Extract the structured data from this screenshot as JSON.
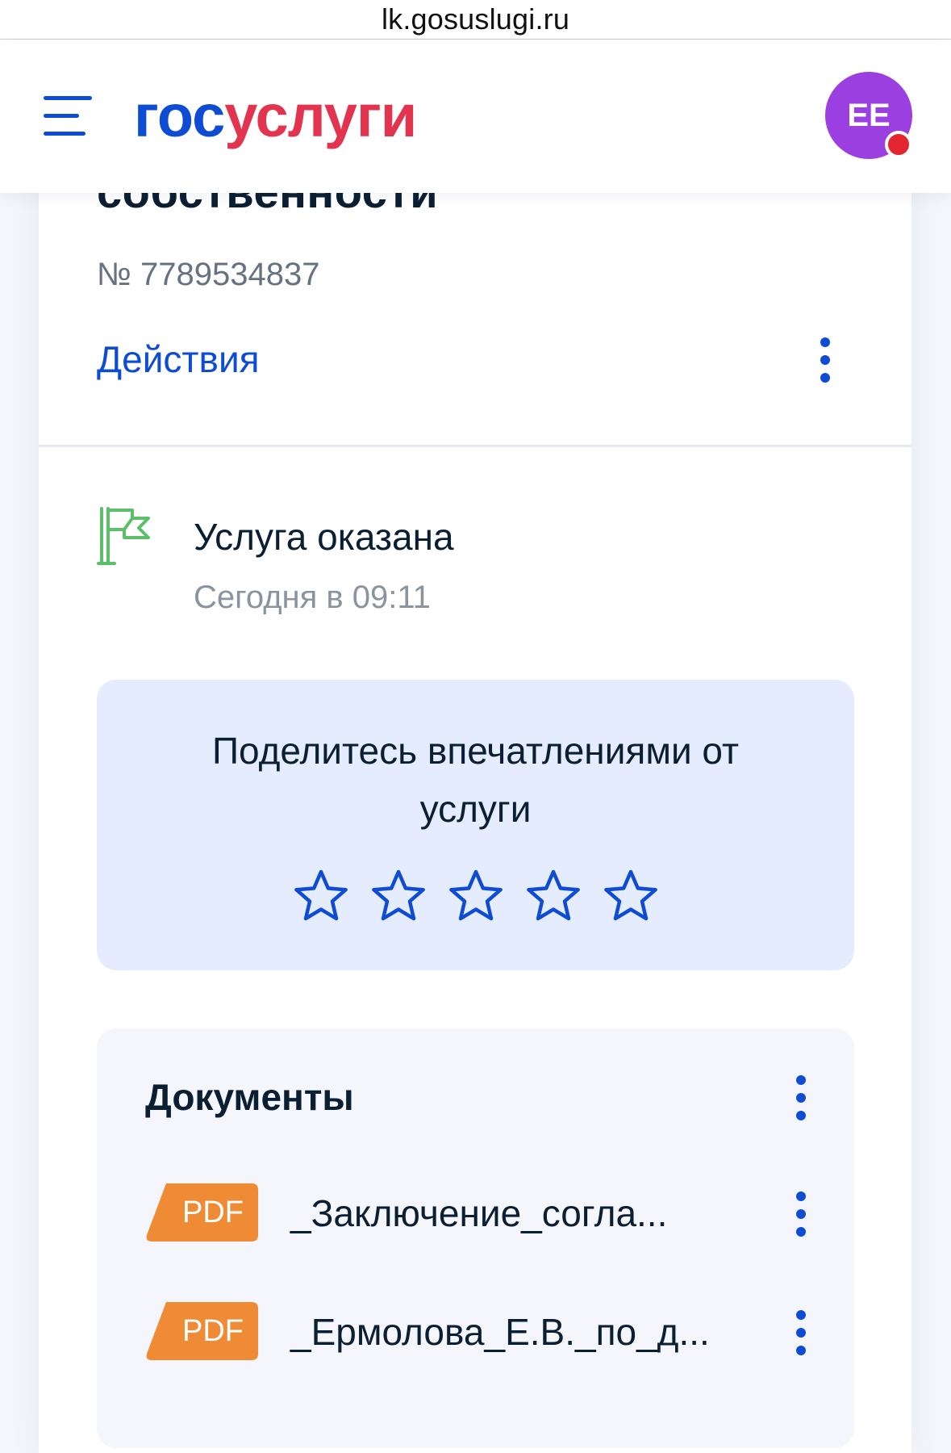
{
  "browser": {
    "url": "lk.gosuslugi.ru"
  },
  "header": {
    "logo_part1": "гос",
    "logo_part2": "услуги",
    "avatar_initials": "ЕЕ"
  },
  "order": {
    "title_fragment": "собственности",
    "number": "№ 7789534837",
    "actions_label": "Действия"
  },
  "status": {
    "title": "Услуга оказана",
    "time": "Сегодня в 09:11"
  },
  "rating": {
    "prompt_line1": "Поделитесь впечатлениями от",
    "prompt_line2": "услуги",
    "stars": 5,
    "selected": 0
  },
  "documents": {
    "title": "Документы",
    "items": [
      {
        "type": "PDF",
        "name": "_Заключение_согла..."
      },
      {
        "type": "PDF",
        "name": "_Ермолова_Е.В._по_д..."
      }
    ]
  },
  "colors": {
    "accent": "#0d4cd3",
    "brand_red": "#e2344e",
    "avatar": "#9b3fe0",
    "pdf_badge": "#ef8b34",
    "success_flag": "#5cbf6a",
    "rating_bg": "#e4ecfd"
  }
}
